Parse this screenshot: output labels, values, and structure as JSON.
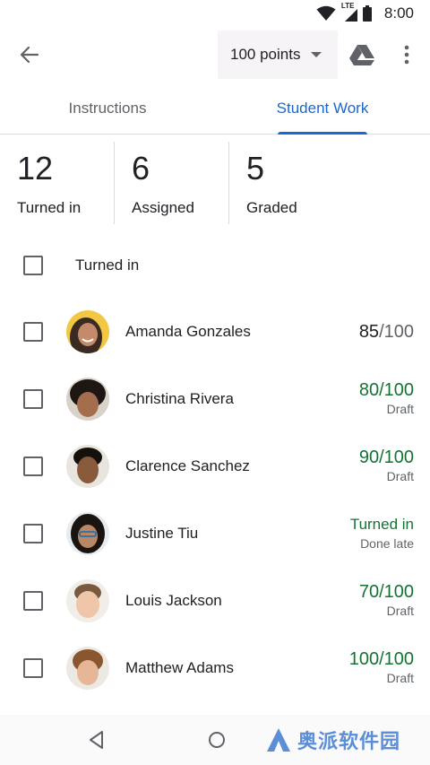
{
  "status_bar": {
    "time": "8:00",
    "network": "LTE"
  },
  "app_bar": {
    "points_label": "100 points"
  },
  "tabs": [
    {
      "label": "Instructions",
      "selected": false
    },
    {
      "label": "Student Work",
      "selected": true
    }
  ],
  "stats": [
    {
      "value": "12",
      "label": "Turned in"
    },
    {
      "value": "6",
      "label": "Assigned"
    },
    {
      "value": "5",
      "label": "Graded"
    }
  ],
  "list": {
    "section_title": "Turned in",
    "students": [
      {
        "name": "Amanda Gonzales",
        "score": "85",
        "denom": "/100",
        "status": ""
      },
      {
        "name": "Christina Rivera",
        "score": "80/100",
        "status": "Draft"
      },
      {
        "name": "Clarence Sanchez",
        "score": "90/100",
        "status": "Draft"
      },
      {
        "name": "Justine Tiu",
        "score": "Turned in",
        "status": "Done late"
      },
      {
        "name": "Louis Jackson",
        "score": "70/100",
        "status": "Draft"
      },
      {
        "name": "Matthew Adams",
        "score": "100/100",
        "status": "Draft"
      }
    ]
  },
  "colors": {
    "accent": "#1967d2",
    "graded_green": "#137333"
  },
  "watermark": {
    "text": "奥派软件园"
  }
}
